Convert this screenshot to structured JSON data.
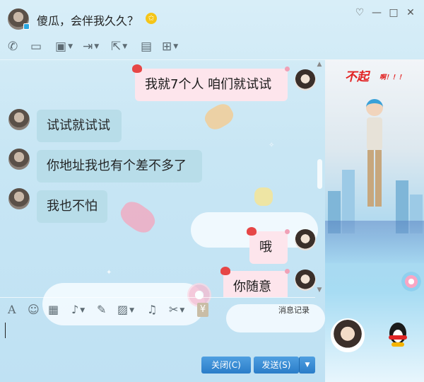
{
  "window": {
    "title": "傻瓜，会伴我久久？",
    "vip_badge": "✩",
    "controls": [
      "♡",
      "—",
      "□",
      "✕"
    ]
  },
  "toolbar": {
    "items": [
      {
        "name": "phone-icon",
        "glyph": "✆"
      },
      {
        "name": "video-icon",
        "glyph": "▭"
      },
      {
        "name": "screen-share-icon",
        "glyph": "▣"
      },
      {
        "name": "file-transfer-icon",
        "glyph": "⇥"
      },
      {
        "name": "remote-assist-icon",
        "glyph": "⇱"
      },
      {
        "name": "message-icon",
        "glyph": "▤"
      },
      {
        "name": "apps-icon",
        "glyph": "⊞"
      }
    ]
  },
  "messages": [
    {
      "direction": "out",
      "text": "我就7个人 咱们就试试"
    },
    {
      "direction": "in",
      "text": "试试就试试"
    },
    {
      "direction": "in",
      "text": "你地址我也有个差不多了"
    },
    {
      "direction": "in",
      "text": "我也不怕"
    },
    {
      "direction": "out",
      "text": "哦"
    },
    {
      "direction": "out",
      "text": "你随意"
    }
  ],
  "side_panel": {
    "title": "不起",
    "subtitle": "啊！！！"
  },
  "input_toolbar": {
    "items": [
      {
        "name": "font-icon",
        "glyph": "A"
      },
      {
        "name": "emoji-icon",
        "glyph": "☺"
      },
      {
        "name": "gif-icon",
        "glyph": "▦"
      },
      {
        "name": "voice-icon",
        "glyph": "♪"
      },
      {
        "name": "pen-icon",
        "glyph": "✎"
      },
      {
        "name": "image-icon",
        "glyph": "▨"
      },
      {
        "name": "music-icon",
        "glyph": "♫"
      },
      {
        "name": "scissors-icon",
        "glyph": "✂"
      },
      {
        "name": "red-packet-icon",
        "glyph": "¥"
      }
    ],
    "history_label": "消息记录"
  },
  "buttons": {
    "close_label": "关闭(C)",
    "send_label": "发送(S)",
    "send_options": "▼"
  }
}
